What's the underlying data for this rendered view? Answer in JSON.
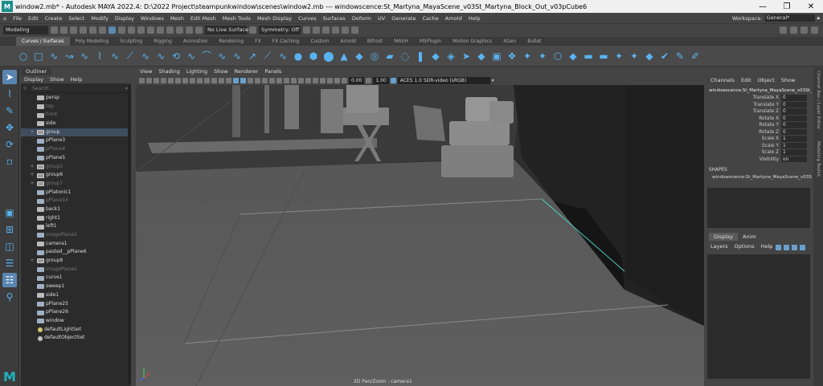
{
  "window": {
    "logo_letter": "M",
    "title": "window2.mb* - Autodesk MAYA 2022.4: D:\\2022 Project\\steampunkwindow\\scenes\\window2.mb  ---  windowscence:St_Martyna_MayaScene_v03St_Martyna_Block_Out_v03pCube6",
    "minimize": "—",
    "maximize": "❐",
    "close": "✕"
  },
  "menubar": {
    "home_icon": "home-icon",
    "items": [
      "File",
      "Edit",
      "Create",
      "Select",
      "Modify",
      "Display",
      "Windows",
      "Mesh",
      "Edit Mesh",
      "Mesh Tools",
      "Mesh Display",
      "Curves",
      "Surfaces",
      "Deform",
      "UV",
      "Generate",
      "Cache",
      "Arnold",
      "Help"
    ],
    "workspace_label": "Workspace:",
    "workspace_value": "General*"
  },
  "statusline": {
    "mode": "Modeling",
    "live_surface": "No Live Surface",
    "symmetry": "Symmetry: Off"
  },
  "shelf": {
    "tabs": [
      "Curves / Surfaces",
      "Poly Modeling",
      "Sculpting",
      "Rigging",
      "Animation",
      "Rendering",
      "FX",
      "FX Caching",
      "Custom",
      "Arnold",
      "Bifrost",
      "MASH",
      "MSPlugin",
      "Motion Graphics",
      "XGen",
      "Bullet"
    ],
    "active_tab": 0,
    "icon_glyphs": [
      "○",
      "□",
      "∿",
      "↝",
      "∿",
      "⌇",
      "∿",
      "⟋",
      "∿",
      "∿",
      "⟲",
      "∿",
      "⌒",
      "∿",
      "∿",
      "↗",
      "⟋",
      "∿",
      "●",
      "⬢",
      "⬤",
      "▲",
      "◆",
      "◎",
      "▰",
      "◌",
      "❚",
      "◆",
      "◈",
      "➤",
      "◆",
      "▣",
      "❖",
      "✦",
      "✦",
      "⬡",
      "◆",
      "▬",
      "▬",
      "✦",
      "✦",
      "◆",
      "✔",
      "✎",
      "✐"
    ]
  },
  "outliner": {
    "tab": "Outliner",
    "menu": [
      "Display",
      "Show",
      "Help"
    ],
    "search_placeholder": "Search...",
    "rows": [
      {
        "label": "persp",
        "icon": "cam",
        "dim": false,
        "expand": ""
      },
      {
        "label": "top",
        "icon": "cam",
        "dim": true,
        "expand": ""
      },
      {
        "label": "front",
        "icon": "cam",
        "dim": true,
        "expand": ""
      },
      {
        "label": "side",
        "icon": "cam",
        "dim": false,
        "expand": ""
      },
      {
        "label": "group",
        "icon": "grp",
        "dim": false,
        "expand": "+",
        "sel": true
      },
      {
        "label": "pPlane3",
        "icon": "mesh",
        "dim": false,
        "expand": ""
      },
      {
        "label": "pPlane4",
        "icon": "mesh",
        "dim": true,
        "expand": ""
      },
      {
        "label": "pPlane5",
        "icon": "mesh",
        "dim": false,
        "expand": ""
      },
      {
        "label": "group5",
        "icon": "grp",
        "dim": true,
        "expand": "+"
      },
      {
        "label": "group6",
        "icon": "grp",
        "dim": false,
        "expand": "+"
      },
      {
        "label": "group7",
        "icon": "grp",
        "dim": true,
        "expand": "+"
      },
      {
        "label": "pPlatonic1",
        "icon": "mesh",
        "dim": false,
        "expand": ""
      },
      {
        "label": "pPlane14",
        "icon": "mesh",
        "dim": true,
        "expand": ""
      },
      {
        "label": "back1",
        "icon": "cam",
        "dim": false,
        "expand": ""
      },
      {
        "label": "right1",
        "icon": "cam",
        "dim": false,
        "expand": ""
      },
      {
        "label": "left1",
        "icon": "cam",
        "dim": false,
        "expand": ""
      },
      {
        "label": "imagePlane1",
        "icon": "mesh",
        "dim": true,
        "expand": ""
      },
      {
        "label": "camera1",
        "icon": "cam",
        "dim": false,
        "expand": ""
      },
      {
        "label": "pasted__pPlane6",
        "icon": "mesh",
        "dim": false,
        "expand": ""
      },
      {
        "label": "group8",
        "icon": "grp",
        "dim": false,
        "expand": "+"
      },
      {
        "label": "imagePlane2",
        "icon": "mesh",
        "dim": true,
        "expand": ""
      },
      {
        "label": "curve1",
        "icon": "mesh",
        "dim": false,
        "expand": ""
      },
      {
        "label": "sweep1",
        "icon": "mesh",
        "dim": false,
        "expand": ""
      },
      {
        "label": "side1",
        "icon": "cam",
        "dim": false,
        "expand": ""
      },
      {
        "label": "pPlane25",
        "icon": "mesh",
        "dim": false,
        "expand": ""
      },
      {
        "label": "pPlane26",
        "icon": "mesh",
        "dim": false,
        "expand": ""
      },
      {
        "label": "window",
        "icon": "mesh",
        "dim": false,
        "expand": ""
      },
      {
        "label": "defaultLightSet",
        "icon": "light",
        "dim": false,
        "expand": ""
      },
      {
        "label": "defaultObjectSet",
        "icon": "set",
        "dim": false,
        "expand": ""
      }
    ]
  },
  "viewport": {
    "menu": [
      "View",
      "Shading",
      "Lighting",
      "Show",
      "Renderer",
      "Panels"
    ],
    "field_a": "0.00",
    "field_b": "1.00",
    "color_space": "ACES 1.0 SDR-video (sRGB)",
    "camera_label": "2D Pan/Zoom : camera1"
  },
  "channelbox": {
    "menu": [
      "Channels",
      "Edit",
      "Object",
      "Show"
    ],
    "object_name": "windowscence:St_Martyna_MayaScene_v03St_Ma...",
    "attributes": [
      {
        "k": "Translate X",
        "v": "0"
      },
      {
        "k": "Translate Y",
        "v": "0"
      },
      {
        "k": "Translate Z",
        "v": "0"
      },
      {
        "k": "Rotate X",
        "v": "0"
      },
      {
        "k": "Rotate Y",
        "v": "0"
      },
      {
        "k": "Rotate Z",
        "v": "0"
      },
      {
        "k": "Scale X",
        "v": "1"
      },
      {
        "k": "Scale Y",
        "v": "1"
      },
      {
        "k": "Scale Z",
        "v": "1"
      },
      {
        "k": "Visibility",
        "v": "on"
      }
    ],
    "shapes_header": "SHAPES",
    "shape_name": "windowscence:St_Martyna_MayaScene_v03St_...",
    "layer_tabs": [
      "Display",
      "Anim"
    ],
    "layer_menu": [
      "Layers",
      "Options",
      "Help"
    ]
  },
  "side_tabs": [
    "Channel Box / Layer Editor",
    "Modeling Toolkit"
  ],
  "colors": {
    "accent": "#5a85b0",
    "maya_teal": "#1fb3c0",
    "edge_highlight": "#4fd0c0"
  }
}
